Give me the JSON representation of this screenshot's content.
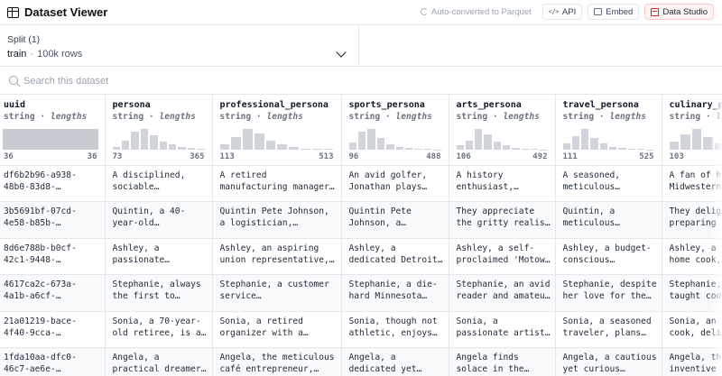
{
  "header": {
    "title": "Dataset Viewer",
    "auto_converted": "Auto-converted to Parquet",
    "api_label": "API",
    "embed_label": "Embed",
    "studio_label": "Data Studio",
    "accent_color": "#dc2626"
  },
  "split": {
    "label": "Split (1)",
    "name": "train",
    "separator": "·",
    "rows": "100k rows"
  },
  "search": {
    "placeholder": "Search this dataset"
  },
  "columns": [
    {
      "name": "uuid",
      "type": "string",
      "stat": "lengths",
      "min": "36",
      "max": "36",
      "hist": [
        1,
        1,
        1,
        1,
        1,
        1,
        1,
        1,
        1,
        1,
        1,
        1
      ]
    },
    {
      "name": "persona",
      "type": "string",
      "stat": "lengths",
      "min": "73",
      "max": "365",
      "hist": [
        0.15,
        0.45,
        0.85,
        1.0,
        0.7,
        0.4,
        0.25,
        0.15,
        0.08,
        0.05
      ]
    },
    {
      "name": "professional_persona",
      "type": "string",
      "stat": "lengths",
      "min": "113",
      "max": "513",
      "hist": [
        0.25,
        0.6,
        1.0,
        0.8,
        0.45,
        0.25,
        0.12,
        0.06,
        0.04,
        0.03
      ]
    },
    {
      "name": "sports_persona",
      "type": "string",
      "stat": "lengths",
      "min": "96",
      "max": "488",
      "hist": [
        0.35,
        0.85,
        1.0,
        0.55,
        0.25,
        0.12,
        0.07,
        0.05,
        0.03,
        0.02
      ]
    },
    {
      "name": "arts_persona",
      "type": "string",
      "stat": "lengths",
      "min": "106",
      "max": "492",
      "hist": [
        0.2,
        0.45,
        1.0,
        0.75,
        0.4,
        0.2,
        0.1,
        0.05,
        0.03,
        0.02
      ]
    },
    {
      "name": "travel_persona",
      "type": "string",
      "stat": "lengths",
      "min": "111",
      "max": "525",
      "hist": [
        0.3,
        0.65,
        1.0,
        0.55,
        0.3,
        0.15,
        0.08,
        0.04,
        0.03,
        0.02
      ]
    },
    {
      "name": "culinary_persona",
      "type": "string",
      "stat": "lengths",
      "min": "103",
      "max": "",
      "hist": [
        0.4,
        0.75,
        1.0,
        0.6,
        0.3,
        0.15,
        0.08
      ]
    }
  ],
  "rows": [
    {
      "uuid": "df6b2b96-a938-\n48b0-83d8-…",
      "persona": "A disciplined,\nsociable…",
      "professional_persona": "A retired\nmanufacturing manager…",
      "sports_persona": "An avid golfer,\nJonathan plays…",
      "arts_persona": "A history\nenthusiast,…",
      "travel_persona": "A seasoned,\nmeticulous…",
      "culinary_persona": "A fan of h\nMidwestern"
    },
    {
      "uuid": "3b5691bf-07cd-\n4e58-b85b-…",
      "persona": "Quintin, a 40-\nyear-old…",
      "professional_persona": "Quintin Pete Johnson,\na logistician,…",
      "sports_persona": "Quintin Pete\nJohnson, a…",
      "arts_persona": "They appreciate\nthe gritty realis…",
      "travel_persona": "Quintin, a\nmeticulous…",
      "culinary_persona": "They delig\npreparing"
    },
    {
      "uuid": "8d6e788b-b0cf-\n42c1-9448-…",
      "persona": "Ashley, a\npassionate…",
      "professional_persona": "Ashley, an aspiring\nunion representative,…",
      "sports_persona": "Ashley, a\ndedicated Detroit…",
      "arts_persona": "Ashley, a self-\nproclaimed 'Motow…",
      "travel_persona": "Ashley, a budget-\nconscious…",
      "culinary_persona": "Ashley, a\nhome cook,"
    },
    {
      "uuid": "4617ca2c-673a-\n4a1b-a6cf-…",
      "persona": "Stephanie, always\nthe first to…",
      "professional_persona": "Stephanie, a customer\nservice…",
      "sports_persona": "Stephanie, a die-\nhard Minnesota…",
      "arts_persona": "Stephanie, an avid\nreader and amateu…",
      "travel_persona": "Stephanie, despite\nher love for the…",
      "culinary_persona": "Stephanie,\ntaught coo"
    },
    {
      "uuid": "21a01219-bace-\n4f40-9cca-…",
      "persona": "Sonia, a 70-year-\nold retiree, is a…",
      "professional_persona": "Sonia, a retired\norganizer with a…",
      "sports_persona": "Sonia, though not\nathletic, enjoys…",
      "arts_persona": "Sonia, a\npassionate artist…",
      "travel_persona": "Sonia, a seasoned\ntraveler, plans…",
      "culinary_persona": "Sonia, an\ncook, deli"
    },
    {
      "uuid": "1fda10aa-dfc0-\n46c7-ae6e-…",
      "persona": "Angela, a\npractical dreamer…",
      "professional_persona": "Angela, the meticulous\ncafé entrepreneur,…",
      "sports_persona": "Angela, a\ndedicated yet…",
      "arts_persona": "Angela finds\nsolace in the…",
      "travel_persona": "Angela, a cautious\nyet curious…",
      "culinary_persona": "Angela, th\ninventive"
    }
  ]
}
